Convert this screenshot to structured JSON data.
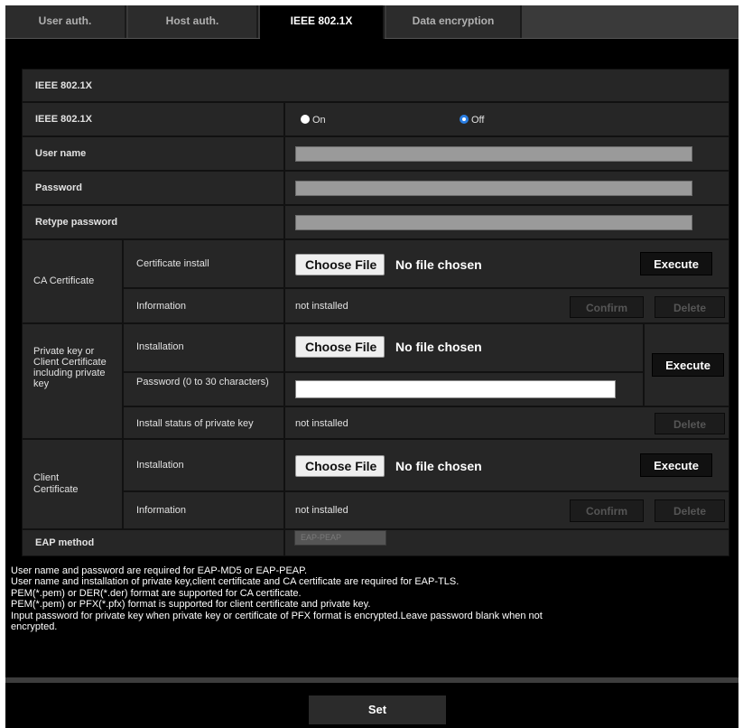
{
  "tabs": [
    {
      "label": "User auth."
    },
    {
      "label": "Host auth."
    },
    {
      "label": "IEEE 802.1X"
    },
    {
      "label": "Data encryption"
    }
  ],
  "section_title": "IEEE 802.1X",
  "ieee8021x": {
    "label": "IEEE 802.1X",
    "on_label": "On",
    "off_label": "Off",
    "selected": "Off"
  },
  "user_name": {
    "label": "User name",
    "value": ""
  },
  "password": {
    "label": "Password",
    "value": ""
  },
  "retype_password": {
    "label": "Retype password",
    "value": ""
  },
  "ca_certificate": {
    "group_label": "CA Certificate",
    "install_label": "Certificate install",
    "choose_file": "Choose File",
    "no_file": "No file chosen",
    "execute": "Execute",
    "info_label": "Information",
    "info_value": "not installed",
    "confirm": "Confirm",
    "delete": "Delete"
  },
  "private_key": {
    "group_label": "Private key or Client Certificate including private key",
    "install_label": "Installation",
    "choose_file": "Choose File",
    "no_file": "No file chosen",
    "password_label": "Password (0 to 30 characters)",
    "password_value": "",
    "execute": "Execute",
    "status_label": "Install status of private key",
    "status_value": "not installed",
    "delete": "Delete"
  },
  "client_certificate": {
    "group_label": "Client Certificate",
    "install_label": "Installation",
    "choose_file": "Choose File",
    "no_file": "No file chosen",
    "execute": "Execute",
    "info_label": "Information",
    "info_value": "not installed",
    "confirm": "Confirm",
    "delete": "Delete"
  },
  "eap_method": {
    "label": "EAP method",
    "value": "EAP-PEAP"
  },
  "notes": [
    "User name and password are required for EAP-MD5 or EAP-PEAP.",
    "User name and installation of private key,client certificate and CA certificate are required for EAP-TLS.",
    "PEM(*.pem) or DER(*.der) format are supported for CA certificate.",
    "PEM(*.pem) or PFX(*.pfx) format is supported for client certificate and private key.",
    "Input password for private key when private key or certificate of PFX format is encrypted.Leave password blank when not",
    "encrypted."
  ],
  "set_button": "Set",
  "colors": {
    "accent_radio": "#2a7de1",
    "background": "#000000",
    "row": "#262626"
  }
}
